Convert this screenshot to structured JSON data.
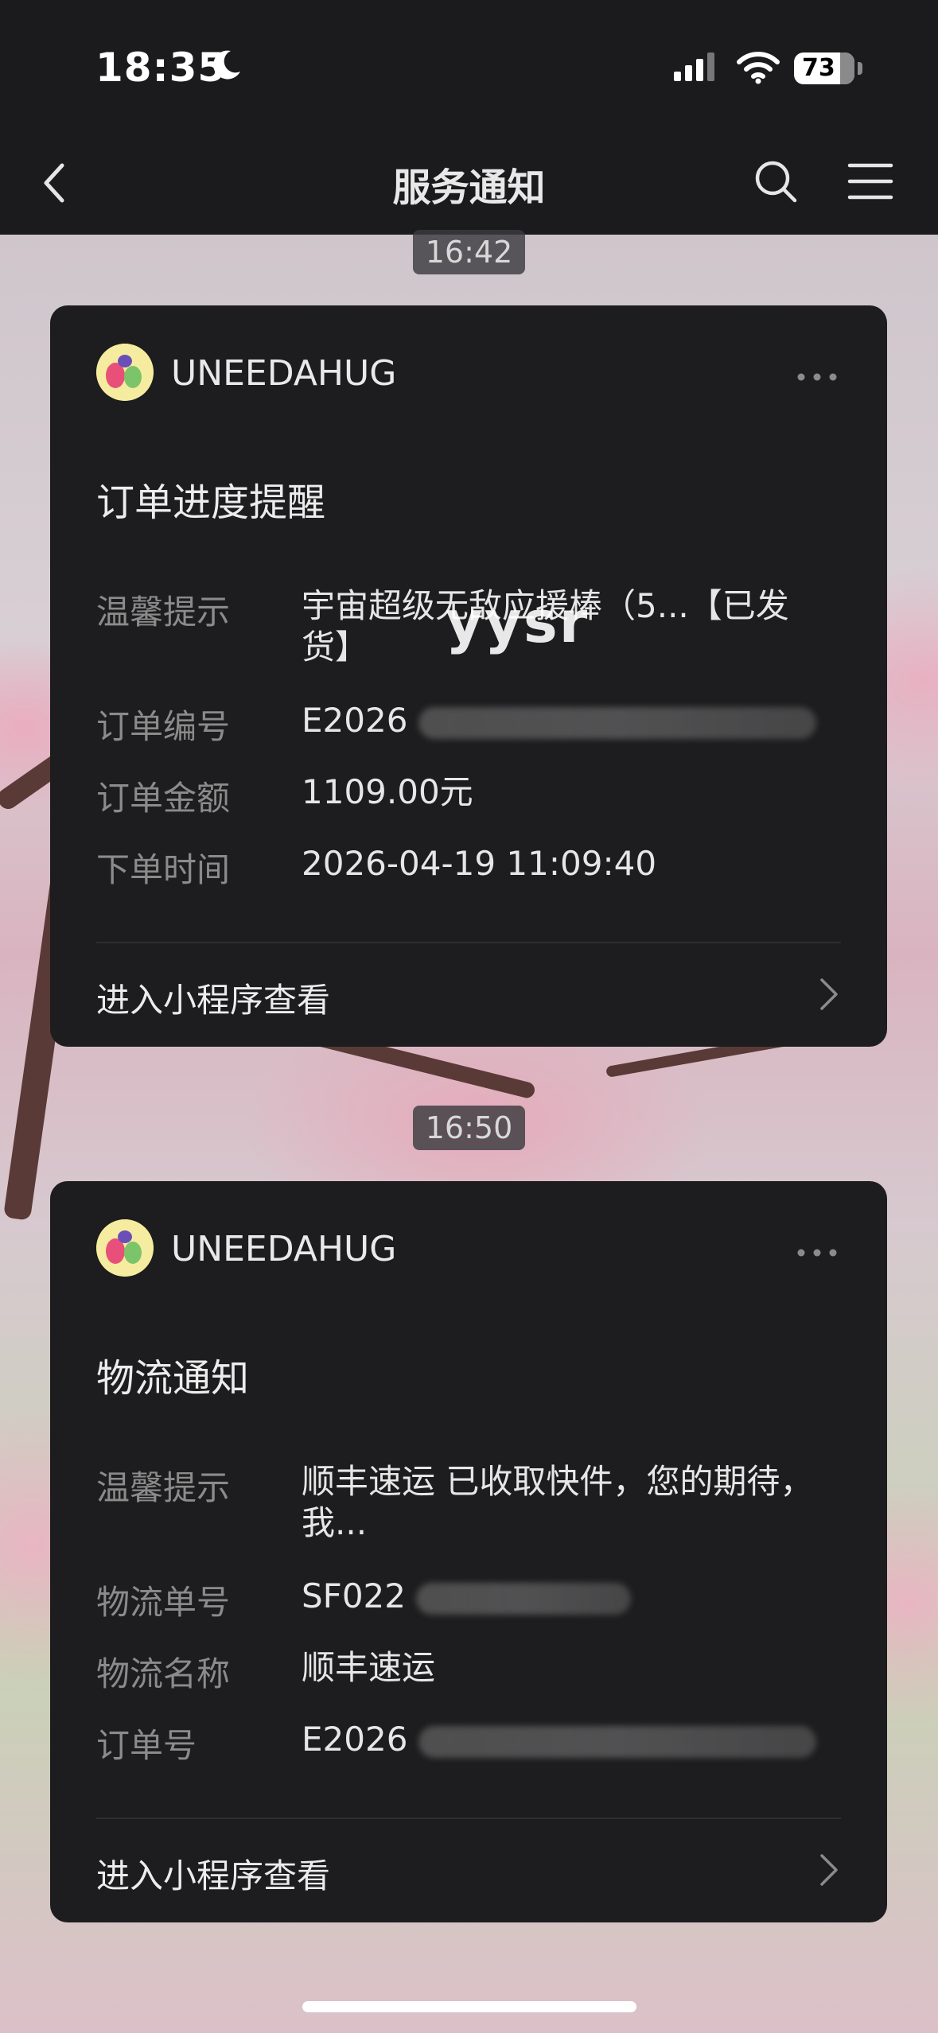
{
  "status_bar": {
    "time": "18:35",
    "battery": "73"
  },
  "nav": {
    "title": "服务通知"
  },
  "messages": [
    {
      "time": "16:42",
      "sender": "UNEEDAHUG",
      "title": "订单进度提醒",
      "rows": [
        {
          "label": "温馨提示",
          "value": "宇宙超级无敌应援棒（5...【已发货】"
        },
        {
          "label": "订单编号",
          "value": "E2026"
        },
        {
          "label": "订单金额",
          "value": "1109.00元"
        },
        {
          "label": "下单时间",
          "value": "2026-04-19 11:09:40"
        }
      ],
      "link": "进入小程序查看"
    },
    {
      "time": "16:50",
      "sender": "UNEEDAHUG",
      "title": "物流通知",
      "rows": [
        {
          "label": "温馨提示",
          "value": "顺丰速运 已收取快件，您的期待，我..."
        },
        {
          "label": "物流单号",
          "value": "SF022"
        },
        {
          "label": "物流名称",
          "value": "顺丰速运"
        },
        {
          "label": "订单号",
          "value": "E2026"
        }
      ],
      "link": "进入小程序查看"
    }
  ],
  "watermark": "yysr",
  "colors": {
    "card_bg": "#1d1d1f",
    "bar_bg": "#1b1b1d",
    "label": "#8b8b8b",
    "text": "#e6e6e6"
  }
}
